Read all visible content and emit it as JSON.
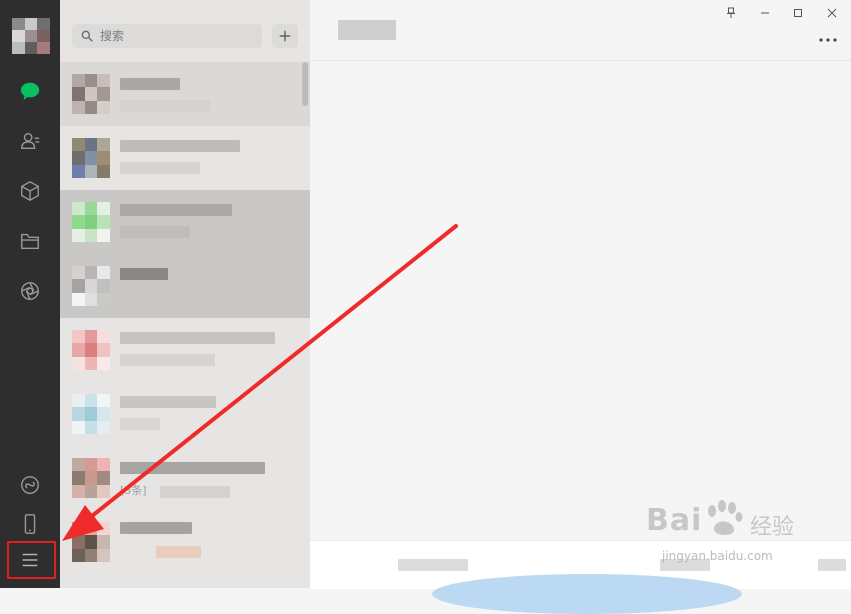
{
  "search": {
    "placeholder": "搜索"
  },
  "chat_list": {
    "items": [
      {
        "note": ""
      },
      {
        "note": ""
      },
      {
        "note": ""
      },
      {
        "note": ""
      },
      {
        "note": ""
      },
      {
        "note": ""
      },
      {
        "note": "[5条]"
      },
      {
        "note": ""
      }
    ]
  },
  "watermark": {
    "brand": "Bai",
    "brand_cn": "经验",
    "url": "jingyan.baidu.com"
  },
  "colors": {
    "rail_bg": "#2e2e2e",
    "accent_green": "#07c160",
    "highlight_red": "#e02020"
  }
}
